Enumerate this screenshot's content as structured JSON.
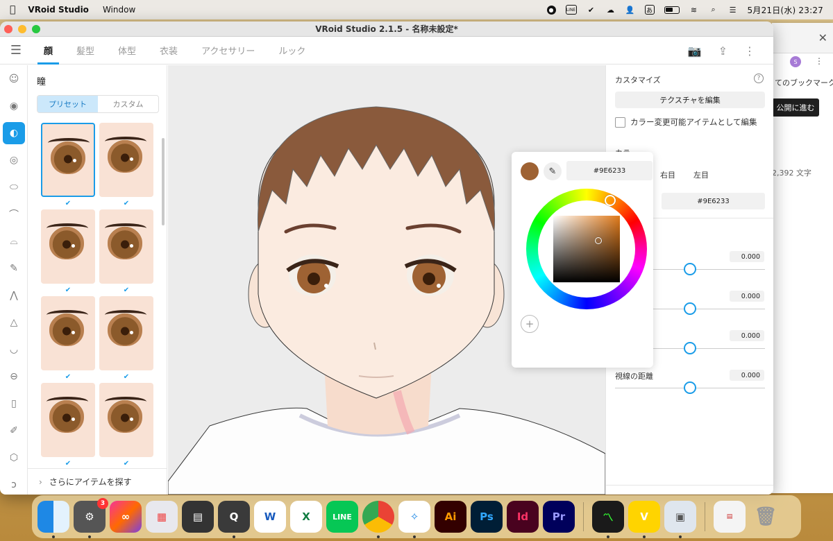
{
  "menubar": {
    "app_name": "VRoid Studio",
    "menu_items": [
      "Window"
    ],
    "status_icons": [
      "record-icon",
      "line-icon",
      "check-circle-icon",
      "creative-cloud-icon",
      "user-icon",
      "input-method-icon",
      "battery-icon",
      "wifi-icon",
      "search-icon",
      "control-center-icon"
    ],
    "input_method_label": "あ",
    "line_label": "LINE",
    "date_time": "5月21日(水)  23:27"
  },
  "browser": {
    "avatar_letter": "S",
    "bookmarks_text": "てのブックマーク",
    "publish_button": "公開に進む",
    "char_count": "2,392 文字"
  },
  "window": {
    "title": "VRoid Studio 2.1.5 - 名称未設定*"
  },
  "tabs": [
    {
      "label": "顔",
      "active": true
    },
    {
      "label": "髪型",
      "active": false
    },
    {
      "label": "体型",
      "active": false
    },
    {
      "label": "衣装",
      "active": false
    },
    {
      "label": "アクセサリー",
      "active": false
    },
    {
      "label": "ルック",
      "active": false
    }
  ],
  "toolbar_icons": [
    "camera-icon",
    "share-icon",
    "more-vertical-icon"
  ],
  "rail_icons": [
    "face-icon",
    "eye-icon",
    "iris-icon",
    "eye-white-icon",
    "eyeline-icon",
    "eyebrow-icon",
    "eyelash-icon",
    "eyedropper-icon",
    "lash-bottom-icon",
    "nose-icon",
    "mouth-icon",
    "lips-icon",
    "teeth-icon",
    "brush-icon",
    "face-shape-icon",
    "ear-icon"
  ],
  "preset_panel": {
    "title": "瞳",
    "segment": {
      "preset": "プリセット",
      "custom": "カスタム"
    },
    "preset_count": 8,
    "selected_index": 0,
    "more_items": "さらにアイテムを探す"
  },
  "customize": {
    "header": "カスタマイズ",
    "help_icon": "?",
    "texture_button": "テクスチャを編集",
    "checkbox_label": "カラー変更可能アイテムとして編集",
    "color_section": "カラー",
    "eye_tabs": [
      "右目",
      "左目"
    ],
    "hex_value": "#9E6233",
    "sliders": [
      {
        "label": "",
        "value": "0.000",
        "position": 0.5
      },
      {
        "label": "",
        "value": "0.000",
        "position": 0.5
      },
      {
        "label": "",
        "value": "0.000",
        "position": 0.5
      },
      {
        "label": "視線の距離",
        "value": "0.000",
        "position": 0.5
      }
    ]
  },
  "picker": {
    "color": "#9E6233",
    "hex_value": "#9E6233",
    "add_label": "+"
  },
  "colors": {
    "accent": "#1a9ce8",
    "eye_color": "#9E6233"
  },
  "dock": {
    "apps": [
      "Finder",
      "System Settings",
      "Creative Cloud",
      "Launchpad",
      "Calculator",
      "QuickTime",
      "Word",
      "Excel",
      "LINE",
      "Chrome",
      "Safari",
      "Illustrator",
      "Photoshop",
      "InDesign",
      "Premiere Pro",
      "Activity Monitor",
      "VRoid Studio",
      "Preview",
      "Document",
      "Trash"
    ],
    "settings_badge": "3",
    "labels": {
      "word": "W",
      "excel": "X",
      "line": "LINE",
      "ai": "Ai",
      "ps": "Ps",
      "id": "Id",
      "pr": "Pr"
    }
  }
}
